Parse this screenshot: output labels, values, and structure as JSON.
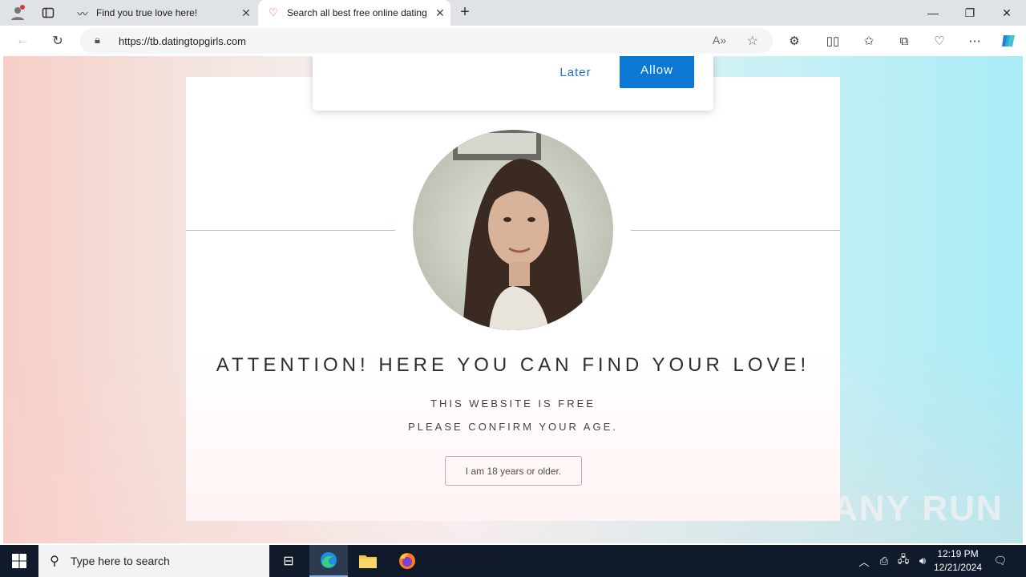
{
  "browser": {
    "tabs": [
      {
        "title": "Find you true love here!",
        "icon": "wave-signature-icon"
      },
      {
        "title": "Search all best free online dating",
        "icon": "heart-icon"
      }
    ],
    "url": "https://tb.datingtopgirls.com"
  },
  "notification": {
    "later_label": "Later",
    "allow_label": "Allow"
  },
  "page": {
    "headline": "ATTENTION! HERE YOU CAN FIND YOUR LOVE!",
    "subline1": "THIS WEBSITE IS FREE",
    "subline2": "PLEASE CONFIRM YOUR AGE.",
    "age_button": "I am 18 years or older."
  },
  "watermark": "ANY RUN",
  "taskbar": {
    "search_placeholder": "Type here to search",
    "time": "12:19 PM",
    "date": "12/21/2024"
  },
  "colors": {
    "allow_button": "#0a78d4",
    "later_text": "#1a73c8",
    "taskbar": "#101a2a"
  }
}
